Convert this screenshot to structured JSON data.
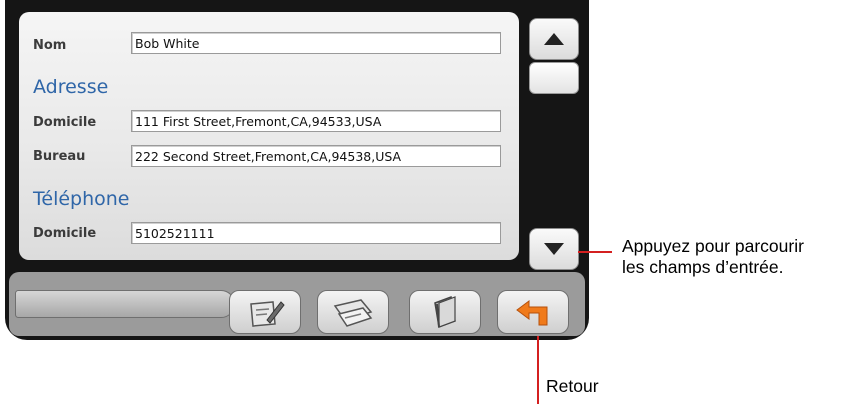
{
  "form": {
    "name_label": "Nom",
    "name_value": "Bob White",
    "address_section": "Adresse",
    "address_home_label": "Domicile",
    "address_home_value": "111 First Street,Fremont,CA,94533,USA",
    "address_work_label": "Bureau",
    "address_work_value": "222 Second Street,Fremont,CA,94538,USA",
    "phone_section": "Téléphone",
    "phone_home_label": "Domicile",
    "phone_home_value": "5102521111"
  },
  "annotations": {
    "scroll_line1": "Appuyez pour parcourir",
    "scroll_line2": "les champs d’entrée.",
    "back": "Retour"
  },
  "colors": {
    "section_heading": "#2f66a8",
    "annotation_line": "#d42020",
    "back_arrow": "#f07a1a"
  },
  "icons": {
    "scroll_up": "triangle-up-icon",
    "scroll_down": "triangle-down-icon",
    "edit": "pencil-edit-icon",
    "note": "note-edit-icon",
    "book": "book-icon",
    "back": "back-arrow-icon"
  }
}
